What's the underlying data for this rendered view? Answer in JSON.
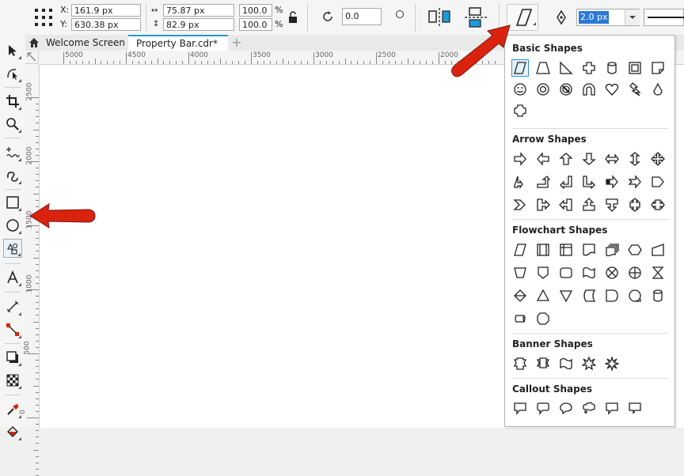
{
  "propbar": {
    "x_label": "X:",
    "x_value": "161.9 px",
    "y_label": "Y:",
    "y_value": "630.38 px",
    "w_value": "75.87 px",
    "h_value": "82.9 px",
    "scale_w": "100.0",
    "scale_h": "100.0",
    "pct1": "%",
    "pct2": "%",
    "rotation": "0.0",
    "outline_width": "2.0 px"
  },
  "tabs": {
    "welcome": "Welcome Screen",
    "doc": "Property Bar.cdr*",
    "add": "+"
  },
  "ruler_h": [
    "5000",
    "4500",
    "4000",
    "3500",
    "3000",
    "2500",
    "2000"
  ],
  "ruler_v": [
    "2500",
    "2000",
    "1500",
    "1000",
    "500",
    "0"
  ],
  "flyout": {
    "sections": [
      {
        "title": "Basic Shapes",
        "count": 15
      },
      {
        "title": "Arrow Shapes",
        "count": 24
      },
      {
        "title": "Flowchart Shapes",
        "count": 23
      },
      {
        "title": "Banner Shapes",
        "count": 5
      },
      {
        "title": "Callout Shapes",
        "count": 6
      }
    ]
  },
  "colors": {
    "accent": "#1e9ad6",
    "arrow": "#d9230f",
    "selected": "#3c8fd6"
  },
  "icons": [
    "pick-tool-icon",
    "shape-tool-icon",
    "crop-tool-icon",
    "zoom-tool-icon",
    "freehand-tool-icon",
    "artistic-media-icon",
    "rectangle-tool-icon",
    "ellipse-tool-icon",
    "common-shapes-tool-icon",
    "text-tool-icon",
    "dimension-tool-icon",
    "connector-tool-icon",
    "drop-shadow-tool-icon",
    "transparency-tool-icon",
    "eyedropper-tool-icon",
    "interactive-fill-icon"
  ]
}
